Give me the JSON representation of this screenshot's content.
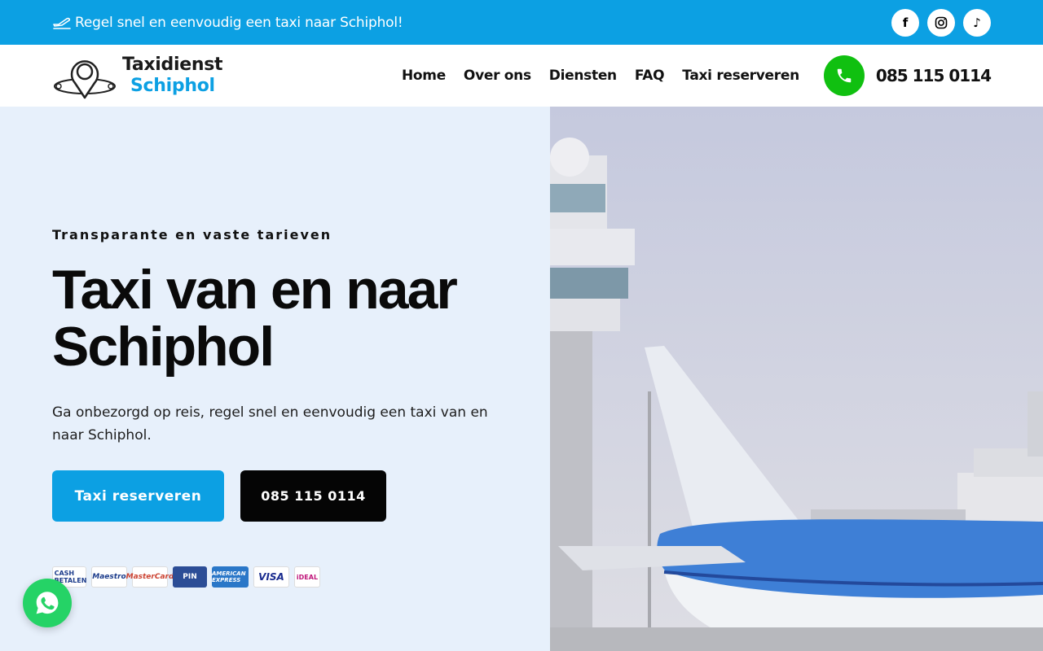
{
  "topbar": {
    "announcement": "Regel snel en eenvoudig een taxi naar Schiphol!",
    "icons": [
      "plane-departure-icon",
      "facebook-icon",
      "instagram-icon",
      "tiktok-icon"
    ],
    "social_glyphs": {
      "facebook": "f",
      "tiktok": "♪"
    },
    "color": "#0ca0e3"
  },
  "header": {
    "logo": {
      "line1": "Taxidienst",
      "line2": "Schiphol"
    },
    "nav": [
      "Home",
      "Over ons",
      "Diensten",
      "FAQ",
      "Taxi reserveren"
    ],
    "phone": "085 115 0114",
    "phone_color": "#10c010"
  },
  "hero": {
    "eyebrow": "Transparante en vaste tarieven",
    "title": "Taxi van en naar Schiphol",
    "description": "Ga onbezorgd op reis, regel snel en eenvoudig een taxi van en naar Schiphol.",
    "primary_button": "Taxi reserveren",
    "secondary_button": "085 115 0114",
    "payments": {
      "cash": "CASH BETALEN",
      "maestro": "Maestro",
      "mastercard": "MasterCard",
      "pin": "PIN",
      "amex": "AMERICAN EXPRESS",
      "visa": "VISA",
      "ideal": "iDEAL"
    },
    "background": "#e7f0fb"
  },
  "whatsapp": {
    "icon": "whatsapp-icon",
    "color": "#25d366"
  }
}
